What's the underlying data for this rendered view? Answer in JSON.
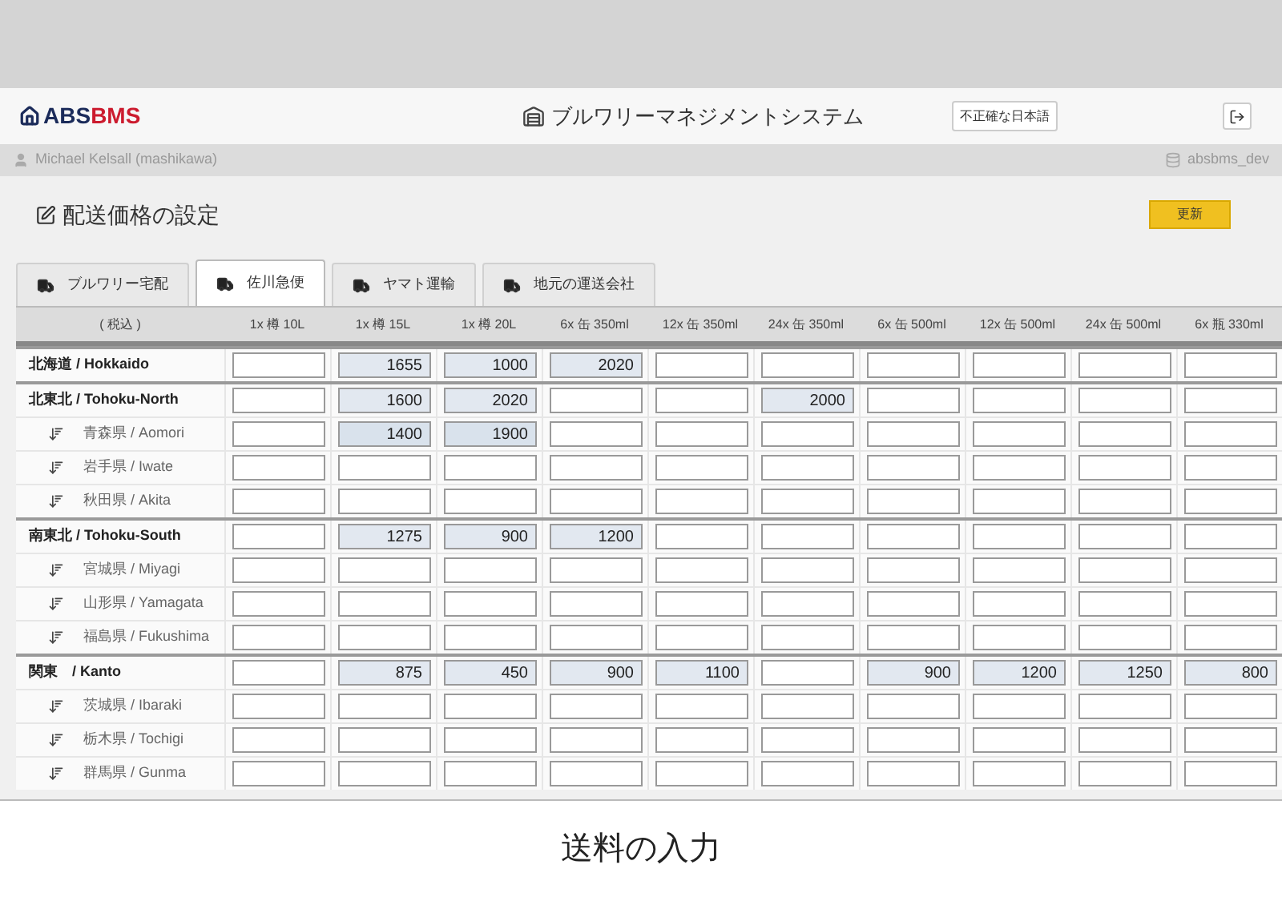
{
  "app_header": {
    "logo": {
      "prefix": "ABS",
      "suffix": "BMS"
    },
    "title": "ブルワリーマネジメントシステム",
    "language_button": "不正確な日本語"
  },
  "user_bar": {
    "user": "Michael Kelsall (mashikawa)",
    "database": "absbms_dev"
  },
  "page": {
    "title": "配送価格の設定",
    "update_button": "更新"
  },
  "tabs": [
    {
      "label": "ブルワリー宅配",
      "selected": false
    },
    {
      "label": "佐川急便",
      "selected": true
    },
    {
      "label": "ヤマト運輸",
      "selected": false
    },
    {
      "label": "地元の運送会社",
      "selected": false
    }
  ],
  "table": {
    "columns": [
      "( 税込 )",
      "1x 樽 10L",
      "1x 樽 15L",
      "1x 樽 20L",
      "6x 缶 350ml",
      "12x 缶 350ml",
      "24x 缶 350ml",
      "6x 缶 500ml",
      "12x 缶 500ml",
      "24x 缶 500ml",
      "6x 瓶 330ml"
    ],
    "regions": [
      {
        "name": "北海道 / Hokkaido",
        "prices": [
          {
            "filled": false
          },
          {
            "filled": true,
            "value": "1655"
          },
          {
            "filled": true,
            "value": "1000"
          },
          {
            "filled": true,
            "value": "2020"
          },
          {
            "filled": false
          },
          {
            "filled": false
          },
          {
            "filled": false
          },
          {
            "filled": false
          },
          {
            "filled": false
          },
          {
            "filled": false
          }
        ]
      },
      {
        "name": "北東北 / Tohoku-North",
        "prices": [
          {
            "filled": false
          },
          {
            "filled": true,
            "value": "1600"
          },
          {
            "filled": true,
            "value": "2020"
          },
          {
            "filled": false
          },
          {
            "filled": false
          },
          {
            "filled": true,
            "value": "2000"
          },
          {
            "filled": false
          },
          {
            "filled": false
          },
          {
            "filled": false
          },
          {
            "filled": false
          }
        ],
        "children": [
          {
            "name": "青森県 / Aomori",
            "prices": [
              {
                "filled": false
              },
              {
                "filled": true,
                "value": "1400"
              },
              {
                "filled": true,
                "value": "1900"
              },
              {
                "filled": false
              },
              {
                "filled": false
              },
              {
                "filled": false
              },
              {
                "filled": false
              },
              {
                "filled": false
              },
              {
                "filled": false
              },
              {
                "filled": false
              }
            ]
          },
          {
            "name": "岩手県 / Iwate",
            "prices": [
              {
                "filled": false
              },
              {
                "filled": false
              },
              {
                "filled": false
              },
              {
                "filled": false
              },
              {
                "filled": false
              },
              {
                "filled": false
              },
              {
                "filled": false
              },
              {
                "filled": false
              },
              {
                "filled": false
              },
              {
                "filled": false
              }
            ]
          },
          {
            "name": "秋田県 / Akita",
            "prices": [
              {
                "filled": false
              },
              {
                "filled": false
              },
              {
                "filled": false
              },
              {
                "filled": false
              },
              {
                "filled": false
              },
              {
                "filled": false
              },
              {
                "filled": false
              },
              {
                "filled": false
              },
              {
                "filled": false
              },
              {
                "filled": false
              }
            ]
          }
        ]
      },
      {
        "name": "南東北 / Tohoku-South",
        "prices": [
          {
            "filled": false
          },
          {
            "filled": true,
            "value": "1275"
          },
          {
            "filled": true,
            "value": "900"
          },
          {
            "filled": true,
            "value": "1200"
          },
          {
            "filled": false
          },
          {
            "filled": false
          },
          {
            "filled": false
          },
          {
            "filled": false
          },
          {
            "filled": false
          },
          {
            "filled": false
          }
        ],
        "children": [
          {
            "name": "宮城県 / Miyagi",
            "prices": [
              {
                "filled": false
              },
              {
                "filled": false
              },
              {
                "filled": false
              },
              {
                "filled": false
              },
              {
                "filled": false
              },
              {
                "filled": false
              },
              {
                "filled": false
              },
              {
                "filled": false
              },
              {
                "filled": false
              },
              {
                "filled": false
              }
            ]
          },
          {
            "name": "山形県 / Yamagata",
            "prices": [
              {
                "filled": false
              },
              {
                "filled": false
              },
              {
                "filled": false
              },
              {
                "filled": false
              },
              {
                "filled": false
              },
              {
                "filled": false
              },
              {
                "filled": false
              },
              {
                "filled": false
              },
              {
                "filled": false
              },
              {
                "filled": false
              }
            ]
          },
          {
            "name": "福島県 / Fukushima",
            "prices": [
              {
                "filled": false
              },
              {
                "filled": false
              },
              {
                "filled": false
              },
              {
                "filled": false
              },
              {
                "filled": false
              },
              {
                "filled": false
              },
              {
                "filled": false
              },
              {
                "filled": false
              },
              {
                "filled": false
              },
              {
                "filled": false
              }
            ]
          }
        ]
      },
      {
        "name": "関東　/ Kanto",
        "prices": [
          {
            "filled": false
          },
          {
            "filled": true,
            "value": "875"
          },
          {
            "filled": true,
            "value": "450"
          },
          {
            "filled": true,
            "value": "900"
          },
          {
            "filled": true,
            "value": "1100"
          },
          {
            "filled": false
          },
          {
            "filled": true,
            "value": "900"
          },
          {
            "filled": true,
            "value": "1200"
          },
          {
            "filled": true,
            "value": "1250"
          },
          {
            "filled": true,
            "value": "800"
          }
        ],
        "children": [
          {
            "name": "茨城県 / Ibaraki",
            "prices": [
              {
                "filled": false
              },
              {
                "filled": false
              },
              {
                "filled": false
              },
              {
                "filled": false
              },
              {
                "filled": false
              },
              {
                "filled": false
              },
              {
                "filled": false
              },
              {
                "filled": false
              },
              {
                "filled": false
              },
              {
                "filled": false
              }
            ]
          },
          {
            "name": "栃木県 / Tochigi",
            "prices": [
              {
                "filled": false
              },
              {
                "filled": false
              },
              {
                "filled": false
              },
              {
                "filled": false
              },
              {
                "filled": false
              },
              {
                "filled": false
              },
              {
                "filled": false
              },
              {
                "filled": false
              },
              {
                "filled": false
              },
              {
                "filled": false
              }
            ]
          },
          {
            "name": "群馬県 / Gunma",
            "prices": [
              {
                "filled": false
              },
              {
                "filled": false
              },
              {
                "filled": false
              },
              {
                "filled": false
              },
              {
                "filled": false
              },
              {
                "filled": false
              },
              {
                "filled": false
              },
              {
                "filled": false
              },
              {
                "filled": false
              },
              {
                "filled": false
              }
            ]
          }
        ]
      }
    ]
  },
  "caption": "送料の入力"
}
